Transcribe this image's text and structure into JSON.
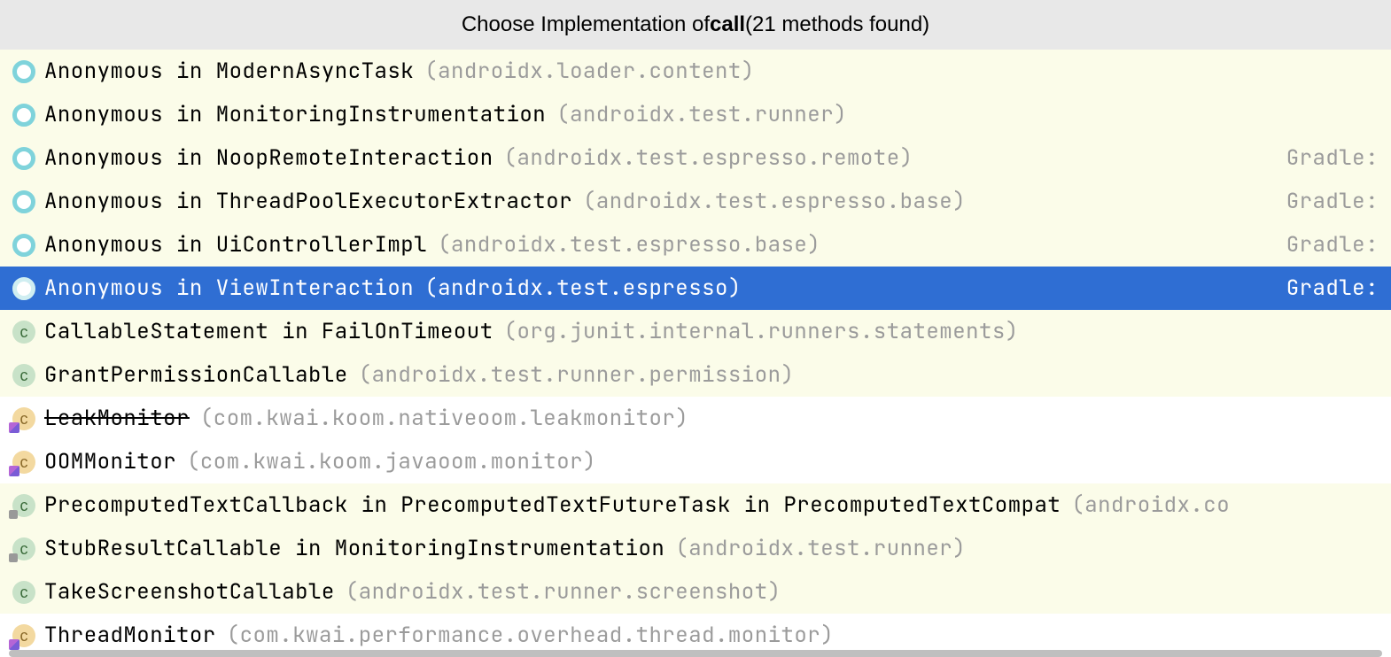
{
  "header": {
    "prefix": "Choose Implementation of ",
    "methodName": "call",
    "suffix": " (21 methods found)"
  },
  "items": [
    {
      "iconType": "ring",
      "badge": "",
      "rowClass": "yellow",
      "main": "Anonymous in ModernAsyncTask",
      "pkg": "(androidx.loader.content)",
      "right": "",
      "strike": false,
      "selected": false
    },
    {
      "iconType": "ring",
      "badge": "",
      "rowClass": "yellow",
      "main": "Anonymous in MonitoringInstrumentation",
      "pkg": "(androidx.test.runner)",
      "right": "",
      "strike": false,
      "selected": false
    },
    {
      "iconType": "ring",
      "badge": "",
      "rowClass": "yellow",
      "main": "Anonymous in NoopRemoteInteraction",
      "pkg": "(androidx.test.espresso.remote)",
      "right": "Gradle:",
      "strike": false,
      "selected": false
    },
    {
      "iconType": "ring",
      "badge": "",
      "rowClass": "yellow",
      "main": "Anonymous in ThreadPoolExecutorExtractor",
      "pkg": "(androidx.test.espresso.base)",
      "right": "Gradle:",
      "strike": false,
      "selected": false
    },
    {
      "iconType": "ring",
      "badge": "",
      "rowClass": "yellow",
      "main": "Anonymous in UiControllerImpl",
      "pkg": "(androidx.test.espresso.base)",
      "right": "Gradle:",
      "strike": false,
      "selected": false
    },
    {
      "iconType": "ring",
      "badge": "",
      "rowClass": "selected",
      "main": "Anonymous in ViewInteraction",
      "pkg": "(androidx.test.espresso)",
      "right": "Gradle:",
      "strike": false,
      "selected": true
    },
    {
      "iconType": "class",
      "badge": "",
      "rowClass": "yellow",
      "main": "CallableStatement in FailOnTimeout",
      "pkg": "(org.junit.internal.runners.statements)",
      "right": "",
      "strike": false,
      "selected": false
    },
    {
      "iconType": "class",
      "badge": "",
      "rowClass": "yellow",
      "main": "GrantPermissionCallable",
      "pkg": "(androidx.test.runner.permission)",
      "right": "",
      "strike": false,
      "selected": false
    },
    {
      "iconType": "orange",
      "badge": "kotlin",
      "rowClass": "white",
      "main": "LeakMonitor",
      "pkg": "(com.kwai.koom.nativeoom.leakmonitor)",
      "right": "",
      "strike": true,
      "selected": false
    },
    {
      "iconType": "orange",
      "badge": "kotlin",
      "rowClass": "white",
      "main": "OOMMonitor",
      "pkg": "(com.kwai.koom.javaoom.monitor)",
      "right": "",
      "strike": false,
      "selected": false
    },
    {
      "iconType": "class",
      "badge": "lib",
      "rowClass": "yellow",
      "main": "PrecomputedTextCallback in PrecomputedTextFutureTask in PrecomputedTextCompat",
      "pkg": "(androidx.co",
      "right": "",
      "strike": false,
      "selected": false
    },
    {
      "iconType": "class",
      "badge": "lib",
      "rowClass": "yellow",
      "main": "StubResultCallable in MonitoringInstrumentation",
      "pkg": "(androidx.test.runner)",
      "right": "",
      "strike": false,
      "selected": false
    },
    {
      "iconType": "class",
      "badge": "",
      "rowClass": "yellow",
      "main": "TakeScreenshotCallable",
      "pkg": "(androidx.test.runner.screenshot)",
      "right": "",
      "strike": false,
      "selected": false
    },
    {
      "iconType": "orange",
      "badge": "kotlin",
      "rowClass": "white",
      "main": "ThreadMonitor",
      "pkg": "(com.kwai.performance.overhead.thread.monitor)",
      "right": "",
      "strike": false,
      "selected": false
    }
  ]
}
